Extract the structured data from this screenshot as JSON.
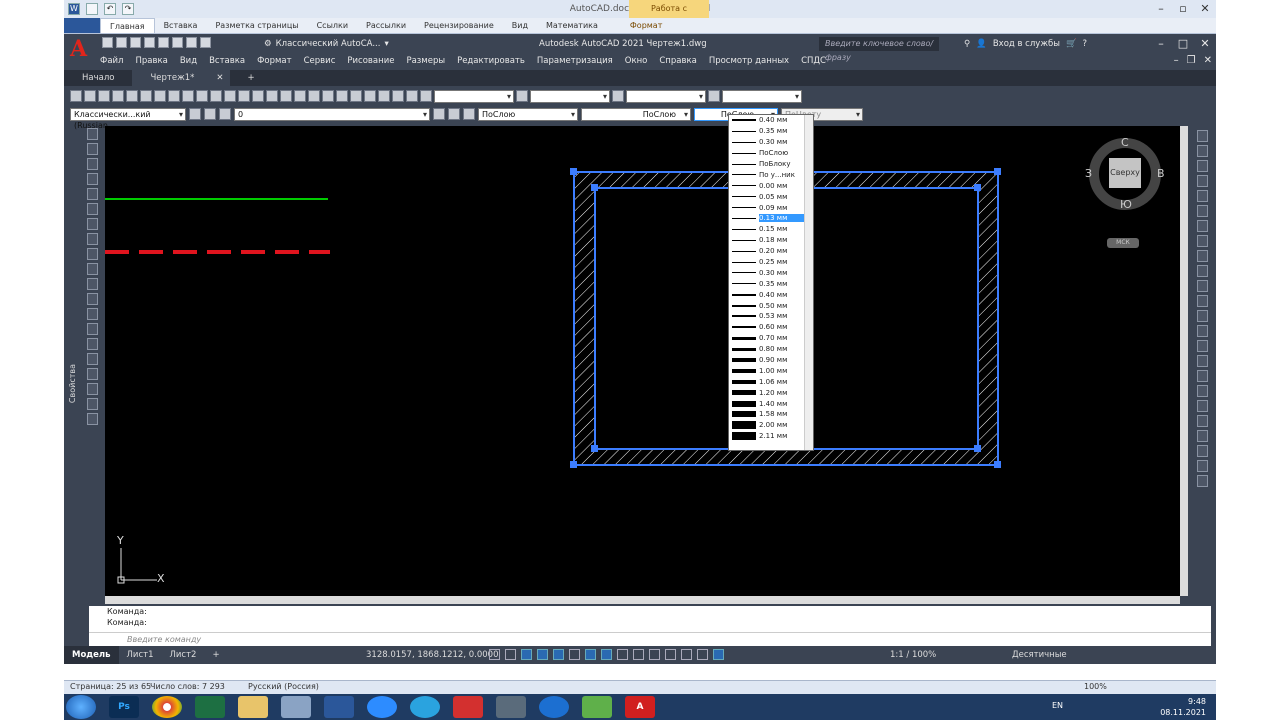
{
  "word": {
    "title": "AutoCAD.docx - Microsoft Word",
    "context_tab": "Работа с рисунками",
    "ribbon_tabs": [
      "Главная",
      "Вставка",
      "Разметка страницы",
      "Ссылки",
      "Рассылки",
      "Рецензирование",
      "Вид",
      "Математика"
    ],
    "format_tab": "Формат",
    "status_page": "Страница: 25 из 65",
    "status_words": "Число слов: 7 293",
    "status_lang": "Русский (Россия)",
    "zoom": "100%"
  },
  "autocad": {
    "logo": "A",
    "workspace": "Классический AutoCA...",
    "title": "Autodesk AutoCAD 2021   Чертеж1.dwg",
    "search_placeholder": "Введите ключевое слово/фразу",
    "signin": "Вход в службы",
    "menu": [
      "Файл",
      "Правка",
      "Вид",
      "Вставка",
      "Формат",
      "Сервис",
      "Рисование",
      "Размеры",
      "Редактировать",
      "Параметризация",
      "Окно",
      "Справка",
      "Просмотр данных",
      "СПДС"
    ],
    "tabs": {
      "start": "Начало",
      "doc": "Чертеж1*",
      "close": "✕",
      "add": "+"
    },
    "toolbar2": {
      "textstyle": "Классически...кий (Russian",
      "layer": "0",
      "color": "ПоСлою",
      "linetype": "ПоСлою",
      "lineweight": "ПоСлою",
      "plotstyle": "ПоЦвету"
    },
    "lineweight_options": [
      {
        "label": "0.40 мм",
        "w": 0.4
      },
      {
        "label": "0.35 мм",
        "w": 0.35
      },
      {
        "label": "0.30 мм",
        "w": 0.3
      },
      {
        "label": "ПоСлою",
        "w": 0.1
      },
      {
        "label": "ПоБлоку",
        "w": 0.1
      },
      {
        "label": "По у...ник",
        "w": 0.1
      },
      {
        "label": "0.00 мм",
        "w": 0.05
      },
      {
        "label": "0.05 мм",
        "w": 0.05
      },
      {
        "label": "0.09 мм",
        "w": 0.09
      },
      {
        "label": "0.13 мм",
        "w": 0.13,
        "selected": true
      },
      {
        "label": "0.15 мм",
        "w": 0.15
      },
      {
        "label": "0.18 мм",
        "w": 0.18
      },
      {
        "label": "0.20 мм",
        "w": 0.2
      },
      {
        "label": "0.25 мм",
        "w": 0.25
      },
      {
        "label": "0.30 мм",
        "w": 0.3
      },
      {
        "label": "0.35 мм",
        "w": 0.35
      },
      {
        "label": "0.40 мм",
        "w": 0.4
      },
      {
        "label": "0.50 мм",
        "w": 0.5
      },
      {
        "label": "0.53 мм",
        "w": 0.53
      },
      {
        "label": "0.60 мм",
        "w": 0.6
      },
      {
        "label": "0.70 мм",
        "w": 0.7
      },
      {
        "label": "0.80 мм",
        "w": 0.8
      },
      {
        "label": "0.90 мм",
        "w": 0.9
      },
      {
        "label": "1.00 мм",
        "w": 1.0
      },
      {
        "label": "1.06 мм",
        "w": 1.06
      },
      {
        "label": "1.20 мм",
        "w": 1.2
      },
      {
        "label": "1.40 мм",
        "w": 1.4
      },
      {
        "label": "1.58 мм",
        "w": 1.58
      },
      {
        "label": "2.00 мм",
        "w": 2.0
      },
      {
        "label": "2.11 мм",
        "w": 2.11
      }
    ],
    "viewcube": {
      "n": "С",
      "s": "Ю",
      "w": "З",
      "e": "В",
      "face": "Сверху",
      "wcs": "МСК"
    },
    "ucs": {
      "y": "Y",
      "x": "X"
    },
    "properties_label": "Свойства",
    "command_history": [
      "Команда:",
      "Команда:"
    ],
    "command_placeholder": "Введите команду",
    "layouts": [
      "Модель",
      "Лист1",
      "Лист2"
    ],
    "layout_add": "+",
    "coords": "3128.0157, 1868.1212, 0.0000",
    "scale": "1:1 / 100%",
    "units": "Десятичные"
  },
  "taskbar": {
    "apps": [
      "Ps",
      "",
      "",
      "",
      "",
      "",
      "",
      "",
      "",
      "",
      "",
      "",
      "",
      "A"
    ],
    "lang": "EN",
    "time": "9:48",
    "date": "08.11.2021"
  },
  "colors": {
    "accent": "#3399ff",
    "autocad_bg": "#3b4453",
    "canvas": "#000000",
    "selection": "#3c7dff"
  }
}
